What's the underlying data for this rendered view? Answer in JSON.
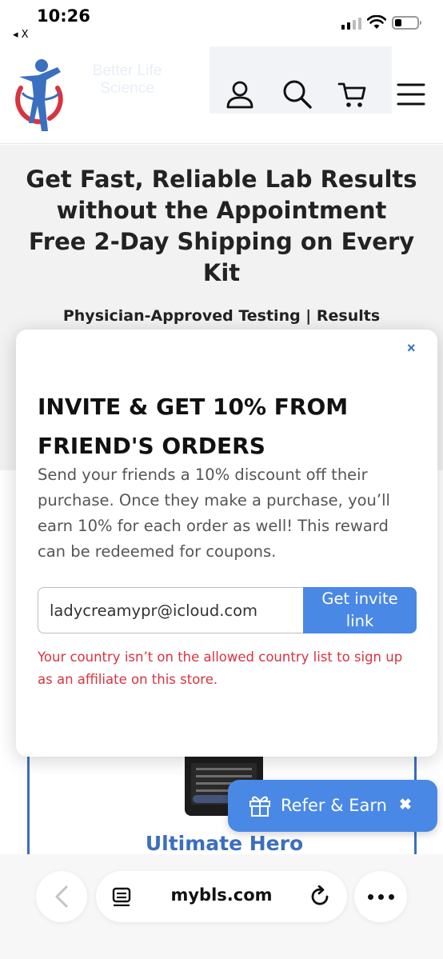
{
  "status_bar": {
    "time": "10:26",
    "back_app": "◂ X"
  },
  "header": {
    "logo_text": "Better Life Science",
    "icons": [
      "account-icon",
      "search-icon",
      "cart-icon",
      "menu-icon"
    ]
  },
  "hero": {
    "title": "Get Fast, Reliable Lab Results without the Appointment Free 2-Day Shipping on Every Kit",
    "subtitle": "Physician-Approved Testing | Results"
  },
  "product": {
    "name": "Ultimate Hero"
  },
  "modal": {
    "close": "×",
    "title": "INVITE & GET 10% FROM FRIEND'S ORDERS",
    "description": "Send your friends a 10% discount off their purchase. Once they make a purchase, you’ll earn 10% for each order as well! This reward can be redeemed for coupons.",
    "email_value": "ladycreamypr@icloud.com",
    "button_label": "Get invite link",
    "error": "Your country isn’t on the allowed country list to sign up as an affiliate on this store."
  },
  "refer": {
    "label": "Refer & Earn",
    "close": "✖"
  },
  "browser": {
    "url": "mybls.com"
  },
  "colors": {
    "accent": "#4a88e6",
    "error": "#d9333f",
    "brand_blue": "#3b6fbf",
    "logo_red": "#d9333f"
  }
}
